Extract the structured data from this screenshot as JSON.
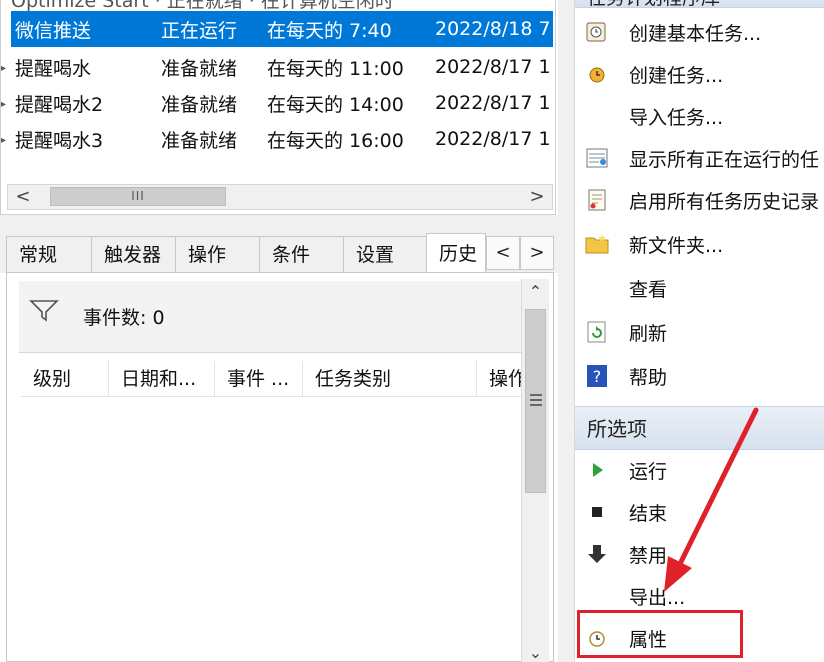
{
  "task_list": {
    "partial_top_row": "Optimize Start · 正在就绪 · 在计算机空闲时",
    "rows": [
      {
        "name": "微信推送",
        "status": "正在运行",
        "trigger": "在每天的 7:40",
        "next_run": "2022/8/18 7",
        "selected": true
      },
      {
        "name": "提醒喝水",
        "status": "准备就绪",
        "trigger": "在每天的 11:00",
        "next_run": "2022/8/17 1",
        "selected": false
      },
      {
        "name": "提醒喝水2",
        "status": "准备就绪",
        "trigger": "在每天的 14:00",
        "next_run": "2022/8/17 1",
        "selected": false
      },
      {
        "name": "提醒喝水3",
        "status": "准备就绪",
        "trigger": "在每天的 16:00",
        "next_run": "2022/8/17 1",
        "selected": false
      }
    ],
    "scroll_left": "<",
    "scroll_right": ">",
    "scroll_thumb": "III"
  },
  "tabs": {
    "items": [
      "常规",
      "触发器",
      "操作",
      "条件",
      "设置",
      "历史"
    ],
    "active": "历史",
    "prev": "<",
    "next": ">"
  },
  "history": {
    "event_count_label": "事件数: 0",
    "columns": [
      "级别",
      "日期和...",
      "事件 ...",
      "任务类别",
      "操作"
    ]
  },
  "actions": {
    "top_header_partial": "任务计划程序库",
    "general": [
      {
        "label": "创建基本任务...",
        "icon": "create-basic-task-icon"
      },
      {
        "label": "创建任务...",
        "icon": "create-task-icon"
      },
      {
        "label": "导入任务...",
        "icon": ""
      },
      {
        "label": "显示所有正在运行的任",
        "icon": "running-tasks-icon"
      },
      {
        "label": "启用所有任务历史记录",
        "icon": "history-icon"
      },
      {
        "label": "新文件夹...",
        "icon": "folder-icon"
      },
      {
        "label": "查看",
        "icon": ""
      },
      {
        "label": "刷新",
        "icon": "refresh-icon"
      },
      {
        "label": "帮助",
        "icon": "help-icon"
      }
    ],
    "selected_header": "所选项",
    "selected": [
      {
        "label": "运行",
        "icon": "run-icon"
      },
      {
        "label": "结束",
        "icon": "stop-icon"
      },
      {
        "label": "禁用",
        "icon": "disable-icon"
      },
      {
        "label": "导出...",
        "icon": ""
      },
      {
        "label": "属性",
        "icon": "properties-icon"
      }
    ]
  },
  "colors": {
    "selection": "#0078d7",
    "annotation": "#e0202a",
    "section_header": "#dbe4ef"
  }
}
